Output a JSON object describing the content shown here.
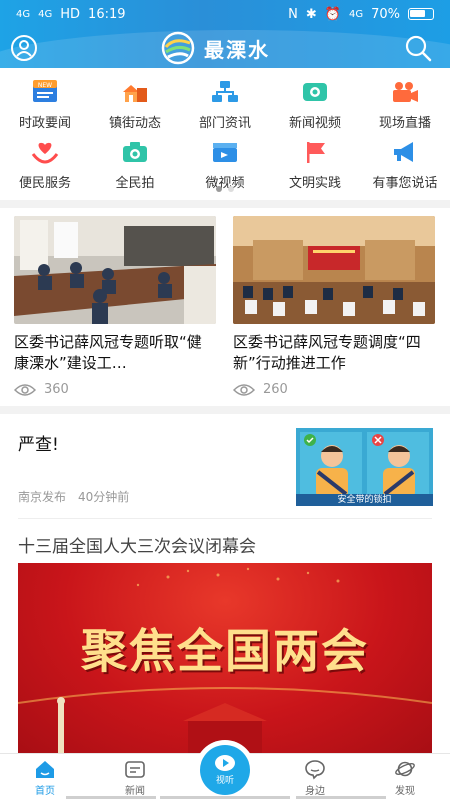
{
  "status": {
    "signal1": "4G",
    "signal2": "4G",
    "hd": "HD",
    "time": "16:19",
    "network": "4G",
    "battery": "70%",
    "battery_level": 0.7
  },
  "app": {
    "title": "最溧水"
  },
  "grid": [
    {
      "label": "时政要闻",
      "icon": "new-badge-icon",
      "badge": "NEW"
    },
    {
      "label": "镇街动态",
      "icon": "buildings-icon"
    },
    {
      "label": "部门资讯",
      "icon": "org-chart-icon"
    },
    {
      "label": "新闻视频",
      "icon": "video-icon"
    },
    {
      "label": "现场直播",
      "icon": "camera-icon"
    },
    {
      "label": "便民服务",
      "icon": "heart-hands-icon"
    },
    {
      "label": "全民拍",
      "icon": "photo-camera-icon"
    },
    {
      "label": "微视频",
      "icon": "clapper-icon"
    },
    {
      "label": "文明实践",
      "icon": "flag-icon"
    },
    {
      "label": "有事您说话",
      "icon": "megaphone-icon"
    }
  ],
  "cards": [
    {
      "title": "区委书记薛风冠专题听取“健康溧水”建设工…",
      "views": "360"
    },
    {
      "title": "区委书记薛风冠专题调度“四新”行动推进工作",
      "views": "260"
    }
  ],
  "news1": {
    "title": "严查!",
    "source": "南京发布",
    "time": "40分钟前",
    "thumb_caption": "安全带的锁扣"
  },
  "news2": {
    "title": "十三届全国人大三次会议闭幕会",
    "banner_text": "聚焦全国两会"
  },
  "tabs": [
    {
      "label": "首页",
      "icon": "home-icon",
      "active": true
    },
    {
      "label": "新闻",
      "icon": "news-icon"
    },
    {
      "label": "视听",
      "icon": "play-icon"
    },
    {
      "label": "身边",
      "icon": "chat-icon"
    },
    {
      "label": "发现",
      "icon": "planet-icon"
    }
  ],
  "colors": {
    "brand": "#1e9be6",
    "banner_red": "#c9151a",
    "banner_gold": "#ffdf8c"
  }
}
